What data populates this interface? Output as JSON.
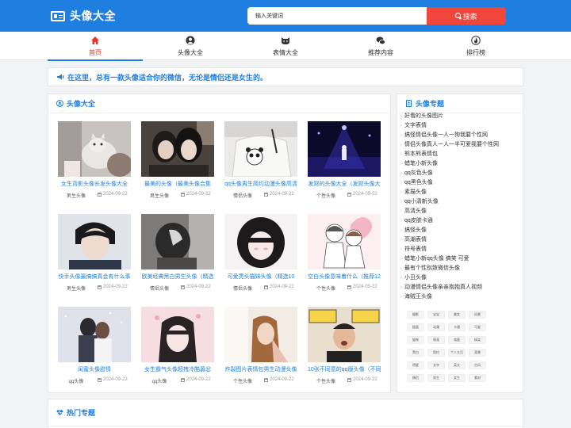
{
  "header": {
    "site_title": "头像大全",
    "search_placeholder": "输入关键词",
    "search_button": "搜索",
    "brand_color": "#1f7fe0",
    "search_color": "#f0463c"
  },
  "nav": {
    "items": [
      {
        "label": "首页",
        "icon": "home-icon",
        "active": true
      },
      {
        "label": "头像大全",
        "icon": "user-circle-icon",
        "active": false
      },
      {
        "label": "表情大全",
        "icon": "cat-face-icon",
        "active": false
      },
      {
        "label": "推荐内容",
        "icon": "chat-bubbles-icon",
        "active": false
      },
      {
        "label": "排行榜",
        "icon": "fire-icon",
        "active": false
      }
    ]
  },
  "notice": {
    "text": "在这里，总有一款头像适合你的微信，无论是情侣还是女生的。"
  },
  "main": {
    "title": "头像大全",
    "cards": [
      {
        "title": "女生背影头像长发头像大全",
        "category": "男生头像",
        "date": "2024-09-22"
      },
      {
        "title": "最美的头像（最美头像合集",
        "category": "男生头像",
        "date": "2024-09-22"
      },
      {
        "title": "qq头像男生简约动漫头像高清",
        "category": "情侣头像",
        "date": "2024-09-22"
      },
      {
        "title": "发财的头像大全（发财头像大",
        "category": "个性头像",
        "date": "2024-09-22"
      },
      {
        "title": "快手头像最搞搞真会有什么事",
        "category": "男生头像",
        "date": "2024-09-22"
      },
      {
        "title": "欧美经典黑白男生头像（精选",
        "category": "情侣头像",
        "date": "2024-09-22"
      },
      {
        "title": "可爱秃头猫妹头像（精选10",
        "category": "情侣头像",
        "date": "2024-09-22"
      },
      {
        "title": "空白头像意味着什么（推荐12",
        "category": "个性头像",
        "date": "2024-09-22"
      },
      {
        "title": "闺蜜头像甜情",
        "category": "qq头像",
        "date": "2024-09-22"
      },
      {
        "title": "女生霸气头像超拽冷酷嚣忿",
        "category": "qq头像",
        "date": "2024-09-22"
      },
      {
        "title": "炸裂图片表情包男生动漫头像",
        "category": "个性头像",
        "date": "2024-09-22"
      },
      {
        "title": "10张不同意的qq版头像（不同意",
        "category": "个性头像",
        "date": "2024-09-22"
      }
    ]
  },
  "side": {
    "title": "头像专题",
    "items": [
      "好看的头像图片",
      "文字表情",
      "搞怪情侣头像一人一狗我要个性网",
      "情侣头像真人一人一半可爱我要个性网",
      "熊本熊表情包",
      "蜡笔小新头像",
      "qq灰色头像",
      "qq黑色头像",
      "素描头像",
      "qq小清新头像",
      "高清头像",
      "qq皮肤卡通",
      "搞怪头像",
      "高潮表情",
      "符号表情",
      "蜡笔小新qq头像 搞笑 可爱",
      "最有个性别致微信头像",
      "小丑头像",
      "动漫情侣头像亲亲抱抱真人视频",
      "海贼王头像"
    ],
    "tags": [
      "摄影",
      "宝宝",
      "美女",
      "风景",
      "插画",
      "动漫",
      "卡通",
      "可爱",
      "猫咪",
      "萌宠",
      "鬼畜",
      "搞笑",
      "黑白",
      "简约",
      "个人主页",
      "背景",
      "明星",
      "文字",
      "英文",
      "古风",
      "情侣",
      "男生",
      "女生",
      "素材"
    ]
  },
  "bottom": {
    "title": "热门专题"
  }
}
